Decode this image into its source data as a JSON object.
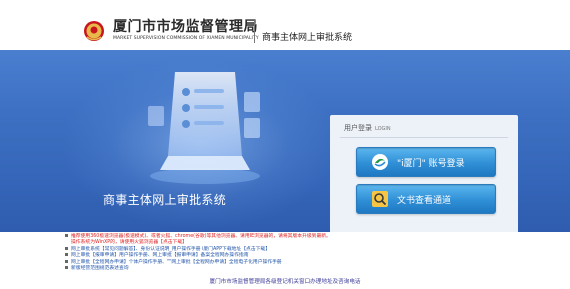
{
  "header": {
    "org_name_cn": "厦门市市场监督管理局",
    "org_name_en": "MARKET SUPERVISION COMMISSION OF XIAMEN MUNICIPALITY",
    "system_name": "商事主体网上审批系统"
  },
  "banner": {
    "title": "商事主体网上审批系统"
  },
  "login": {
    "title": "用户登录",
    "title_en": "LOGIN",
    "account_button": "\"i厦门\" 账号登录",
    "document_button": "文书查看通道"
  },
  "notes": [
    {
      "text": "推荐使用360极速浏览器(极速模式)、或者火狐、chrome(谷歌)等其他浏览器、请用IE浏览器的，请将其版本升级到最新。",
      "color": "red"
    },
    {
      "text": "操作系统为WinXP的，请使用火狐浏览器【点击下载】",
      "color": "red"
    },
    {
      "text": "网上审批系统【常见问题解答】、身份认证说明_用户操作手册 i厦门APP下载地址【点击下载】",
      "color": "blue"
    },
    {
      "text": "网上审批【报审申请】用户操作手册、网上审批【报审申请】备案全程网办操作指南",
      "color": "blue"
    },
    {
      "text": "网上审批【全程网办申请】个体户操作手册、\"\"网上审批【全程网办申请】全程电子化用户操作手册",
      "color": "blue"
    },
    {
      "text": "新版经营范围规范表述查询",
      "color": "blue"
    }
  ],
  "footer": "厦门市市场监督管理局各级登记机关窗口办理地址及咨询电话",
  "colors": {
    "banner_blue": "#3d70c2",
    "button_blue": "#2f8fd6",
    "note_red": "#d22222",
    "note_blue": "#2255aa"
  },
  "icons": [
    "market-supervision-emblem-icon",
    "iXiamen-logo-icon",
    "search-document-icon"
  ]
}
